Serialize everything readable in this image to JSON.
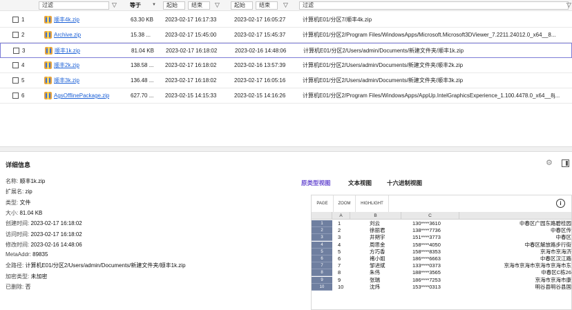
{
  "filters": {
    "name_placeholder": "过滤",
    "size_label": "等于",
    "date1_start": "起始",
    "date1_end": "结束",
    "date2_start": "起始",
    "date2_end": "结束",
    "path_placeholder": "过滤"
  },
  "rows": [
    {
      "index": "1",
      "name": "顺丰4k.zip",
      "size": "63.30 KB",
      "created": "2023-02-17 16:17:33",
      "modified": "2023-02-17 16:05:27",
      "path": "计算机E01/分区7/顺丰4k.zip"
    },
    {
      "index": "2",
      "name": "Archive.zip",
      "size": "15.38 ...",
      "created": "2023-02-17 15:45:00",
      "modified": "2023-02-17 15:45:37",
      "path": "计算机E01/分区2/Program Files/WindowsApps/Microsoft.Microsoft3DViewer_7.2211.24012.0_x64__8..."
    },
    {
      "index": "3",
      "name": "顺丰1k.zip",
      "size": "81.04 KB",
      "created": "2023-02-17 16:18:02",
      "modified": "2023-02-16 14:48:06",
      "path": "计算机E01/分区2/Users/admin/Documents/新建文件夹/顺丰1k.zip"
    },
    {
      "index": "4",
      "name": "顺丰2k.zip",
      "size": "138.58 ...",
      "created": "2023-02-17 16:18:02",
      "modified": "2023-02-16 13:57:39",
      "path": "计算机E01/分区2/Users/admin/Documents/新建文件夹/顺丰2k.zip"
    },
    {
      "index": "5",
      "name": "顺丰3k.zip",
      "size": "136.48 ...",
      "created": "2023-02-17 16:18:02",
      "modified": "2023-02-17 16:05:16",
      "path": "计算机E01/分区2/Users/admin/Documents/新建文件夹/顺丰3k.zip"
    },
    {
      "index": "6",
      "name": "AgsOfflinePackage.zip",
      "size": "627.70 ...",
      "created": "2023-02-15 14:15:33",
      "modified": "2023-02-15 14:16:26",
      "path": "计算机E01/分区2/Program Files/WindowsApps/AppUp.IntelGraphicsExperience_1.100.4478.0_x64__8j..."
    }
  ],
  "details": {
    "title": "详细信息",
    "props": [
      {
        "k": "名称:",
        "v": "顺丰1k.zip"
      },
      {
        "k": "扩展名:",
        "v": "zip"
      },
      {
        "k": "类型:",
        "v": "文件"
      },
      {
        "k": "大小:",
        "v": "81.04 KB"
      },
      {
        "k": "创建时间:",
        "v": "2023-02-17 16:18:02"
      },
      {
        "k": "访问时间:",
        "v": "2023-02-17 16:18:02"
      },
      {
        "k": "修改时间:",
        "v": "2023-02-16 14:48:06"
      },
      {
        "k": "MetaAddr:",
        "v": "89835"
      },
      {
        "k": "全路径:",
        "v": "计算机E01/分区2/Users/admin/Documents/新建文件夹/顺丰1k.zip"
      },
      {
        "k": "加密类型:",
        "v": "未加密"
      },
      {
        "k": "已删除:",
        "v": "否"
      }
    ],
    "tabs": [
      "原类型视图",
      "文本视图",
      "十六进制视图"
    ]
  },
  "preview": {
    "toolbar": [
      "PAGE",
      "ZOOM",
      "HIGHLIGHT"
    ],
    "col_headers": [
      "A",
      "B",
      "C"
    ],
    "rows": [
      {
        "rn": "1",
        "a": "1",
        "b": "刘云",
        "c": "130****3610",
        "d": "中春区广园东路碧桂园"
      },
      {
        "rn": "2",
        "a": "2",
        "b": "徐丽君",
        "c": "138****7736",
        "d": "中春区传"
      },
      {
        "rn": "3",
        "a": "3",
        "b": "井朔宇",
        "c": "151****3773",
        "d": "中春区"
      },
      {
        "rn": "4",
        "a": "4",
        "b": "周思金",
        "c": "158****4050",
        "d": "中春区解放路步行街"
      },
      {
        "rn": "5",
        "a": "5",
        "b": "方巧香",
        "c": "158****8353",
        "d": "京海市京海济"
      },
      {
        "rn": "6",
        "a": "6",
        "b": "褚小姐",
        "c": "186****6663",
        "d": "中春区汉江路"
      },
      {
        "rn": "7",
        "a": "7",
        "b": "邹进斌",
        "c": "133****0373",
        "d": "京海市京海市京海市京海市东"
      },
      {
        "rn": "8",
        "a": "8",
        "b": "朱伟",
        "c": "188****3565",
        "d": "中春区C栋26"
      },
      {
        "rn": "9",
        "a": "9",
        "b": "张瑞",
        "c": "186****7253",
        "d": "京海市京海市康"
      },
      {
        "rn": "10",
        "a": "10",
        "b": "沈炜",
        "c": "153****0313",
        "d": "明谷县明谷县国"
      }
    ]
  }
}
